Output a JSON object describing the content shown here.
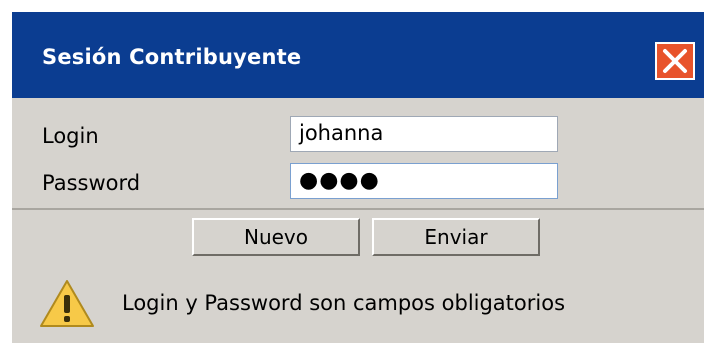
{
  "dialog": {
    "title": "Sesión Contribuyente",
    "close_icon": "close-icon"
  },
  "form": {
    "login_label": "Login",
    "login_value": "johanna",
    "password_label": "Password",
    "password_mask": "●●●●"
  },
  "buttons": {
    "nuevo": "Nuevo",
    "enviar": "Enviar"
  },
  "alert": {
    "icon": "warning-icon",
    "message": "Login y Password son campos obligatorios"
  },
  "colors": {
    "titlebar": "#0b3d91",
    "dialog_bg": "#d6d3ce",
    "close_button": "#e8532b",
    "warning_fill": "#f7c948"
  }
}
